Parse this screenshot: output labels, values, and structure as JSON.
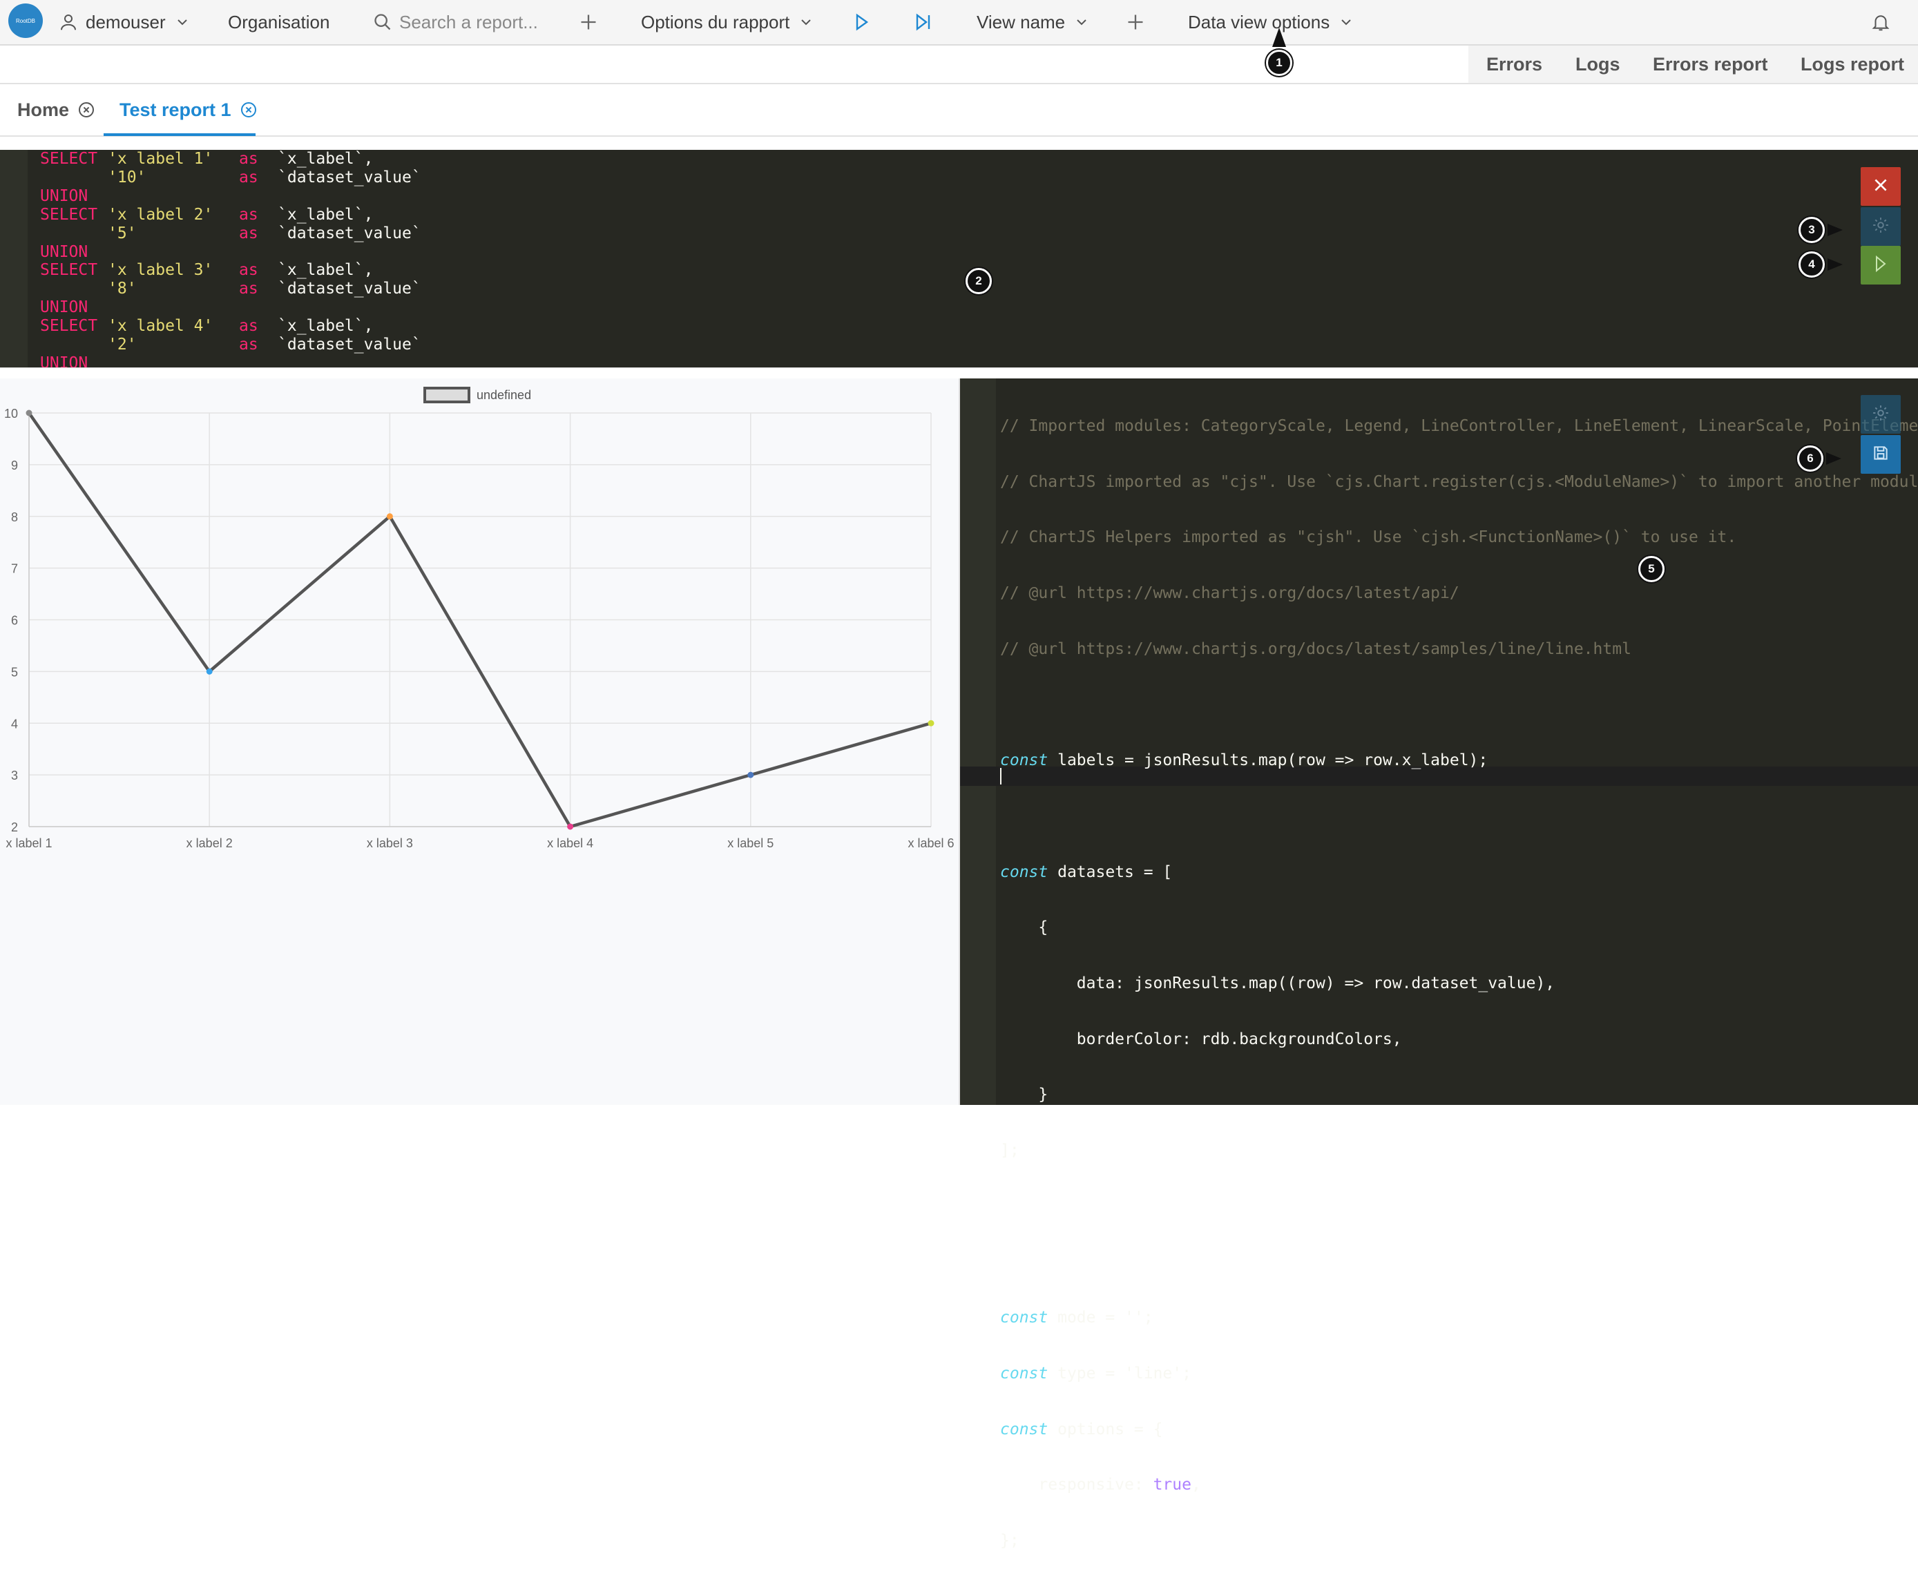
{
  "nav": {
    "logo_text": "RootDB",
    "user": "demouser",
    "organisation": "Organisation",
    "search_placeholder": "Search a report...",
    "report_options": "Options du rapport",
    "view_name": "View name",
    "data_view_options": "Data view options"
  },
  "secondary_nav": {
    "errors": "Errors",
    "logs": "Logs",
    "errors_report": "Errors report",
    "logs_report": "Logs report"
  },
  "tabs": [
    {
      "label": "Home"
    },
    {
      "label": "Test report 1"
    }
  ],
  "sql_lines": [
    {
      "kw": "SELECT",
      "str": "'x label 1'",
      "as": "as",
      "alias": "`x_label`,"
    },
    {
      "str": "'10'",
      "as": "as",
      "alias": "`dataset_value`"
    },
    {
      "kw": "UNION"
    },
    {
      "kw": "SELECT",
      "str": "'x label 2'",
      "as": "as",
      "alias": "`x_label`,"
    },
    {
      "str": "'5'",
      "as": "as",
      "alias": "`dataset_value`"
    },
    {
      "kw": "UNION"
    },
    {
      "kw": "SELECT",
      "str": "'x label 3'",
      "as": "as",
      "alias": "`x_label`,"
    },
    {
      "str": "'8'",
      "as": "as",
      "alias": "`dataset_value`"
    },
    {
      "kw": "UNION"
    },
    {
      "kw": "SELECT",
      "str": "'x label 4'",
      "as": "as",
      "alias": "`x_label`,"
    },
    {
      "str": "'2'",
      "as": "as",
      "alias": "`dataset_value`"
    },
    {
      "kw": "UNION"
    }
  ],
  "js_code": {
    "comments": [
      "// Imported modules: CategoryScale, Legend, LineController, LineElement, LinearScale, PointElement,",
      "// ChartJS imported as \"cjs\". Use `cjs.Chart.register(cjs.<ModuleName>)` to import another module",
      "// ChartJS Helpers imported as \"cjsh\". Use `cjsh.<FunctionName>()` to use it.",
      "// @url https://www.chartjs.org/docs/latest/api/",
      "// @url https://www.chartjs.org/docs/latest/samples/line/line.html"
    ],
    "line_labels": "labels = jsonResults.map(row => row.x_label);",
    "line_datasets": "datasets = [",
    "line_open": "{",
    "line_data": "data: jsonResults.map((row) => row.dataset_value),",
    "line_border": "borderColor: rdb.backgroundColors,",
    "line_close": "}",
    "line_end": "];",
    "line_mode": "mode = '';",
    "line_type": "type = 'line';",
    "line_options": "options = {",
    "line_responsive_key": "responsive:",
    "line_responsive_val": "true",
    "line_options_end": "};",
    "kw_const": "const"
  },
  "annotations": [
    "1",
    "2",
    "3",
    "4",
    "5",
    "6"
  ],
  "colors": {
    "accent": "#1e88d2",
    "close_button": "#c0392b",
    "run_button": "#5b8c35",
    "save_button": "#1e6fa8",
    "line": "#555555",
    "point_colors": [
      "#888888",
      "#36a2eb",
      "#ff9f40",
      "#e83e8c",
      "#4b77be",
      "#cddc39"
    ]
  },
  "chart_data": {
    "type": "line",
    "categories": [
      "x label 1",
      "x label 2",
      "x label 3",
      "x label 4",
      "x label 5",
      "x label 6"
    ],
    "series": [
      {
        "name": "undefined",
        "values": [
          10,
          5,
          8,
          2,
          3,
          4
        ]
      }
    ],
    "ylim": [
      2,
      10
    ],
    "yticks": [
      2,
      3,
      4,
      5,
      6,
      7,
      8,
      9,
      10
    ],
    "grid": true,
    "legend": "top-center"
  }
}
